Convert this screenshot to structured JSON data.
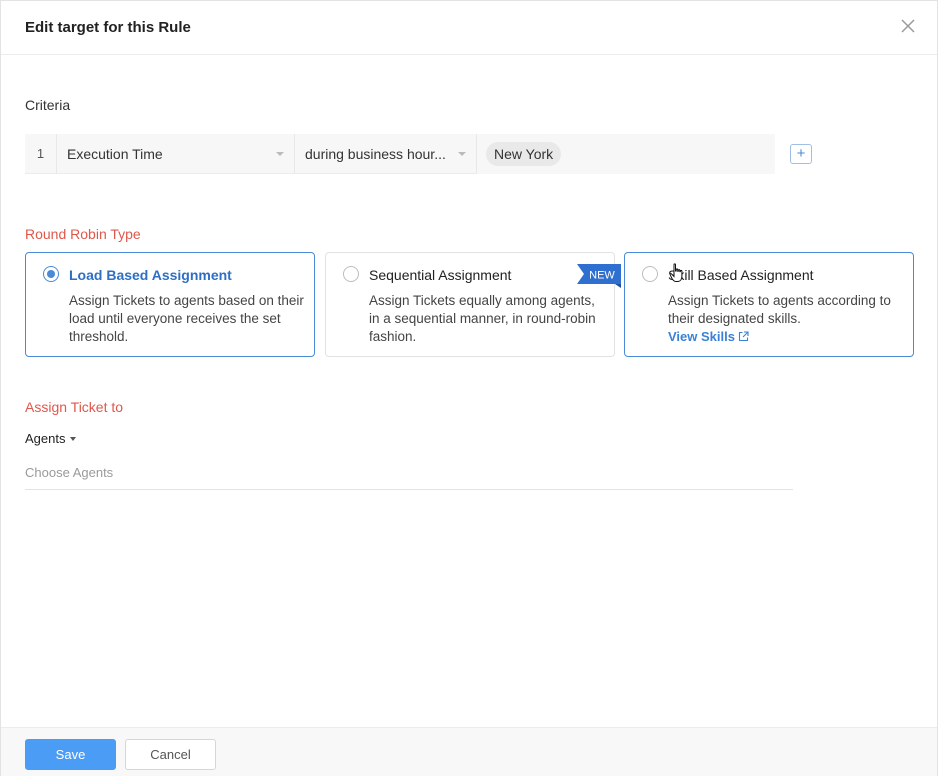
{
  "dialog": {
    "title": "Edit target for this Rule"
  },
  "criteria": {
    "label": "Criteria",
    "rows": [
      {
        "index": "1",
        "field": "Execution Time",
        "condition": "during business hour...",
        "value": "New York"
      }
    ],
    "add_label": "+"
  },
  "round_robin": {
    "label": "Round Robin Type",
    "options": [
      {
        "title": "Load Based Assignment",
        "desc": "Assign Tickets to agents based on their load until everyone receives the set threshold.",
        "selected": true
      },
      {
        "title": "Sequential Assignment",
        "desc": "Assign Tickets equally among agents, in a sequential manner, in round-robin fashion.",
        "badge": "NEW"
      },
      {
        "title": "Skill Based Assignment",
        "desc": "Assign Tickets to agents according to their designated skills.",
        "link": "View Skills"
      }
    ]
  },
  "assign": {
    "label": "Assign Ticket to",
    "type_label": "Agents",
    "placeholder": "Choose Agents"
  },
  "footer": {
    "save_label": "Save",
    "cancel_label": "Cancel"
  },
  "colors": {
    "accent": "#4a8ad6",
    "section_label": "#e0574b",
    "save_button": "#4b9cf5",
    "badge": "#2f6fd0"
  },
  "icons": {
    "close": "close-icon",
    "add": "plus-icon",
    "external": "external-link-icon",
    "cursor": "hand-pointer-icon"
  }
}
